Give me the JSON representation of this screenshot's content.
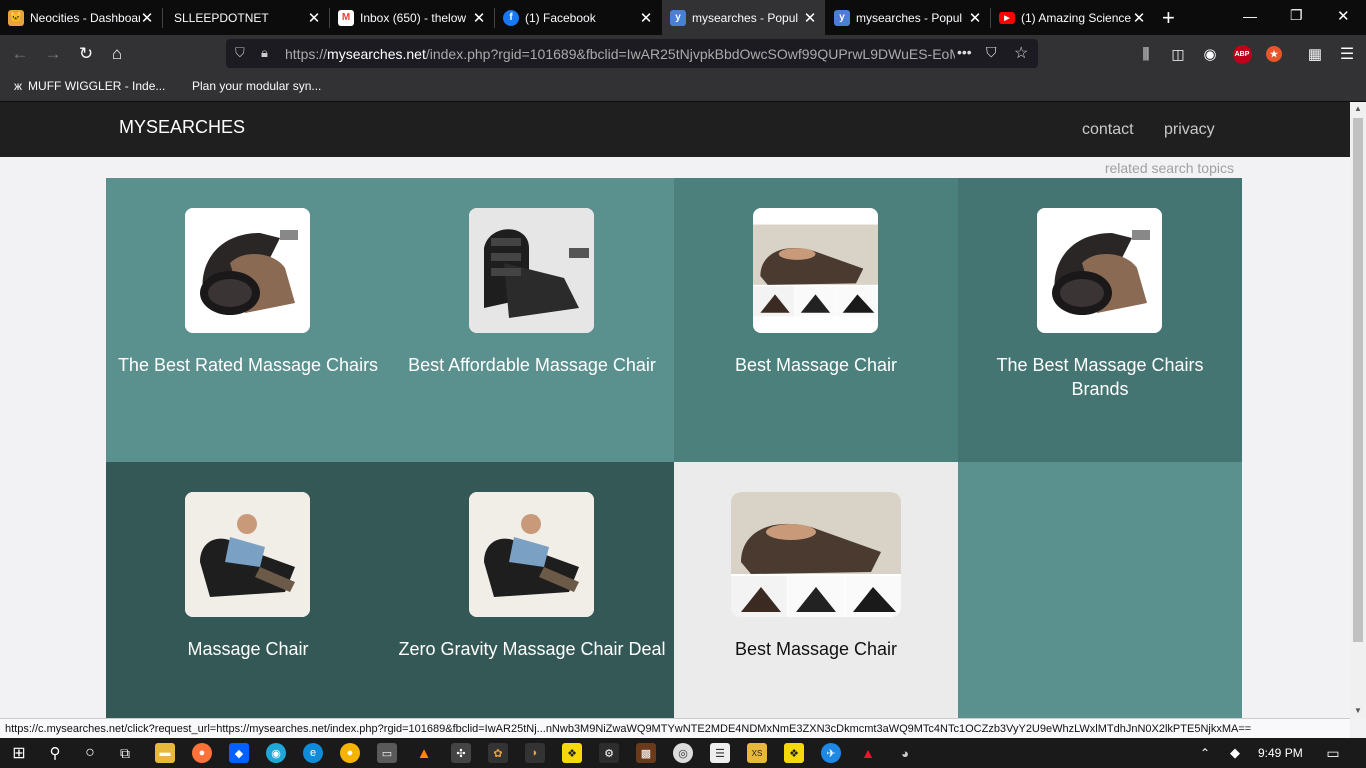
{
  "tabs": [
    {
      "title": "Neocities - Dashboard",
      "icon": "cat-icon",
      "color": "#e8a33b"
    },
    {
      "title": "SLLEEPDOTNET",
      "icon": "blank-icon",
      "color": "#0c0c0d"
    },
    {
      "title": "Inbox (650) - thelow",
      "icon": "gmail-icon",
      "color": "#ea4335"
    },
    {
      "title": "(1) Facebook",
      "icon": "facebook-icon",
      "color": "#1877f2"
    },
    {
      "title": "mysearches - Popul",
      "icon": "y-icon",
      "color": "#4a7fd6"
    },
    {
      "title": "mysearches - Popul",
      "icon": "y-icon",
      "color": "#4a7fd6"
    },
    {
      "title": "(1) Amazing Science",
      "icon": "youtube-icon",
      "color": "#ff0000"
    }
  ],
  "url": {
    "scheme": "https://",
    "host": "mysearches.net",
    "path": "/index.php?rgid=101689&fbclid=IwAR25tNjvpkBbdOwcSOwf99QUPrwL9DWuES-EoM"
  },
  "bookmarks": [
    {
      "label": "MUFF WIGGLER - Inde..."
    },
    {
      "label": "Plan your modular syn..."
    }
  ],
  "site": {
    "logo": "MYSEARCHES",
    "nav": [
      "contact",
      "privacy"
    ],
    "related": "related search topics"
  },
  "tiles": [
    {
      "label": "The Best Rated Massage Chairs",
      "bg": "#5a918e",
      "img": "chair-a"
    },
    {
      "label": "Best Affordable Massage Chair",
      "bg": "#5a918e",
      "img": "chair-b"
    },
    {
      "label": "Best Massage Chair",
      "bg": "#4c807d",
      "img": "chair-c"
    },
    {
      "label": "The Best Massage Chairs Brands",
      "bg": "#447573",
      "img": "chair-a"
    },
    {
      "label": "Massage Chair",
      "bg": "#335856",
      "img": "chair-d"
    },
    {
      "label": "Zero Gravity Massage Chair Deal",
      "bg": "#335856",
      "img": "chair-d"
    },
    {
      "label": "Best Massage Chair",
      "bg": "#ebebeb",
      "img": "chair-c"
    },
    {
      "label": "",
      "bg": "#5a918e",
      "img": ""
    }
  ],
  "status": "https://c.mysearches.net/click?request_url=https://mysearches.net/index.php?rgid=101689&fbclid=IwAR25tNj...nNwb3M9NiZwaWQ9MTYwNTE2MDE4NDMxNmE3ZXN3cDkmcmt3aWQ9MTc4NTc1OCZzb3VyY2U9eWhzLWxlMTdhJnN0X2lkPTE5NjkxMA==",
  "clock": "9:49 PM"
}
